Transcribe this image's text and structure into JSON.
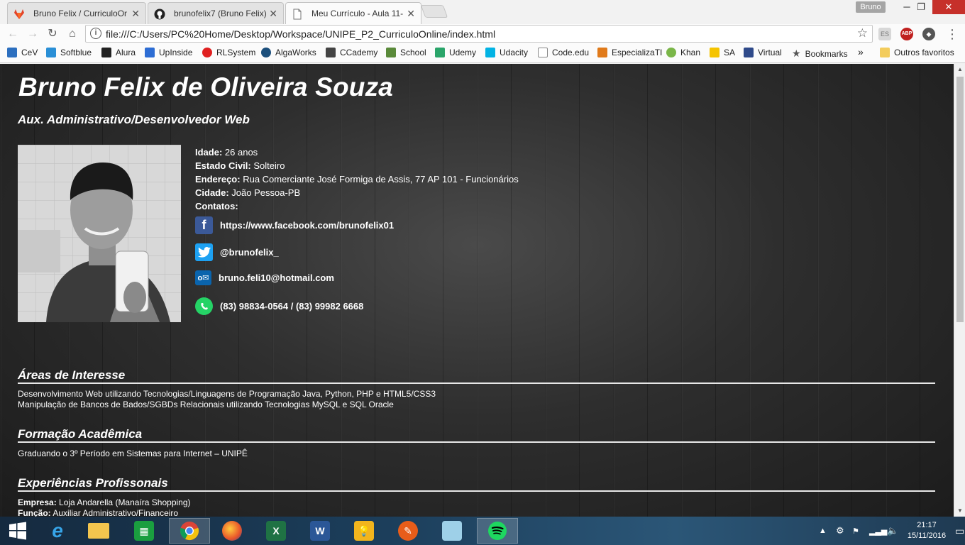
{
  "tabs": [
    {
      "label": "Bruno Felix / CurriculoOn",
      "icon": "gitlab-icon",
      "active": false
    },
    {
      "label": "brunofelix7 (Bruno Felix)",
      "icon": "github-icon",
      "active": false
    },
    {
      "label": "Meu Currículo - Aula 11-",
      "icon": "page-icon",
      "active": true
    }
  ],
  "window": {
    "profile": "Bruno"
  },
  "address": {
    "url": "file:///C:/Users/PC%20Home/Desktop/Workspace/UNIPE_P2_CurriculoOnline/index.html"
  },
  "extensions": {
    "es": "ES",
    "abp": "ABP"
  },
  "bookmarks": [
    {
      "label": "CeV",
      "icon": "cev-icon",
      "color": "#2c6fbf"
    },
    {
      "label": "Softblue",
      "icon": "softblue-icon",
      "color": "#2a8fd6"
    },
    {
      "label": "Alura",
      "icon": "alura-icon",
      "color": "#222222"
    },
    {
      "label": "UpInside",
      "icon": "upinside-icon",
      "color": "#2d6dd4"
    },
    {
      "label": "RLSystem",
      "icon": "rlsystem-icon",
      "color": "#e02020"
    },
    {
      "label": "AlgaWorks",
      "icon": "algaworks-icon",
      "color": "#1c4f7c"
    },
    {
      "label": "CCademy",
      "icon": "ccademy-icon",
      "color": "#444444"
    },
    {
      "label": "School",
      "icon": "school-icon",
      "color": "#5a8a3a"
    },
    {
      "label": "Udemy",
      "icon": "udemy-icon",
      "color": "#2aa56a"
    },
    {
      "label": "Udacity",
      "icon": "udacity-icon",
      "color": "#02b3e4"
    },
    {
      "label": "Code.edu",
      "icon": "page-icon",
      "color": "#888888"
    },
    {
      "label": "EspecializaTI",
      "icon": "especializati-icon",
      "color": "#e07a1a"
    },
    {
      "label": "Khan",
      "icon": "khan-icon",
      "color": "#7ab648"
    },
    {
      "label": "SA",
      "icon": "sa-icon",
      "color": "#f5c400"
    },
    {
      "label": "Virtual",
      "icon": "virtual-icon",
      "color": "#2f4a8a"
    },
    {
      "label": "Bookmarks",
      "icon": "star-icon",
      "color": "#555555"
    }
  ],
  "bookmarks_more": "»",
  "other_bookmarks": "Outros favoritos",
  "resume": {
    "name": "Bruno Felix de Oliveira Souza",
    "role": "Aux. Administrativo/Desenvolvedor Web",
    "age_label": "Idade:",
    "age": "26 anos",
    "civil_label": "Estado Civil:",
    "civil": "Solteiro",
    "address_label": "Endereço:",
    "address": "Rua Comerciante José Formiga de Assis, 77 AP 101 - Funcionários",
    "city_label": "Cidade:",
    "city": "João Pessoa-PB",
    "contacts_label": "Contatos:",
    "facebook": "https://www.facebook.com/brunofelix01",
    "twitter": "@brunofelix_",
    "email": "bruno.feli10@hotmail.com",
    "phone": "(83) 98834-0564 / (83) 99982 6668"
  },
  "sections": {
    "interests_title": "Áreas de Interesse",
    "interests_1": "Desenvolvimento Web utilizando Tecnologias/Linguagens de Programação Java, Python, PHP e HTML5/CSS3",
    "interests_2": "Manipulação de Bancos de Bados/SGBDs Relacionais utilizando Tecnologias MySQL e SQL Oracle",
    "education_title": "Formação Acadêmica",
    "education_1": "Graduando o 3º Período em Sistemas para Internet – UNIPÊ",
    "experience_title": "Experiências Profissonais",
    "company_label": "Empresa:",
    "company": "Loja Andarella (Manaíra Shopping)",
    "function_label": "Função:",
    "function": "Auxiliar Administrativo/Financeiro"
  },
  "clock": {
    "time": "21:17",
    "date": "15/11/2016"
  }
}
